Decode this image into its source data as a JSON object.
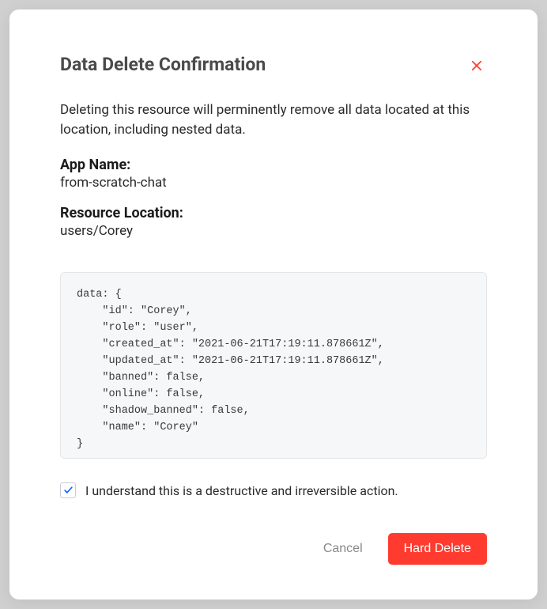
{
  "modal": {
    "title": "Data Delete Confirmation",
    "description": "Deleting this resource will perminently remove all data located at this location, including nested data.",
    "app_name_label": "App Name:",
    "app_name_value": "from-scratch-chat",
    "resource_location_label": "Resource Location:",
    "resource_location_value": "users/Corey",
    "code_preview": "data: {\n    \"id\": \"Corey\",\n    \"role\": \"user\",\n    \"created_at\": \"2021-06-21T17:19:11.878661Z\",\n    \"updated_at\": \"2021-06-21T17:19:11.878661Z\",\n    \"banned\": false,\n    \"online\": false,\n    \"shadow_banned\": false,\n    \"name\": \"Corey\"\n}",
    "confirm_text": "I understand this is a destructive and irreversible action.",
    "confirm_checked": true,
    "cancel_label": "Cancel",
    "delete_label": "Hard Delete"
  },
  "colors": {
    "danger": "#ff3b30",
    "check": "#005fff"
  }
}
